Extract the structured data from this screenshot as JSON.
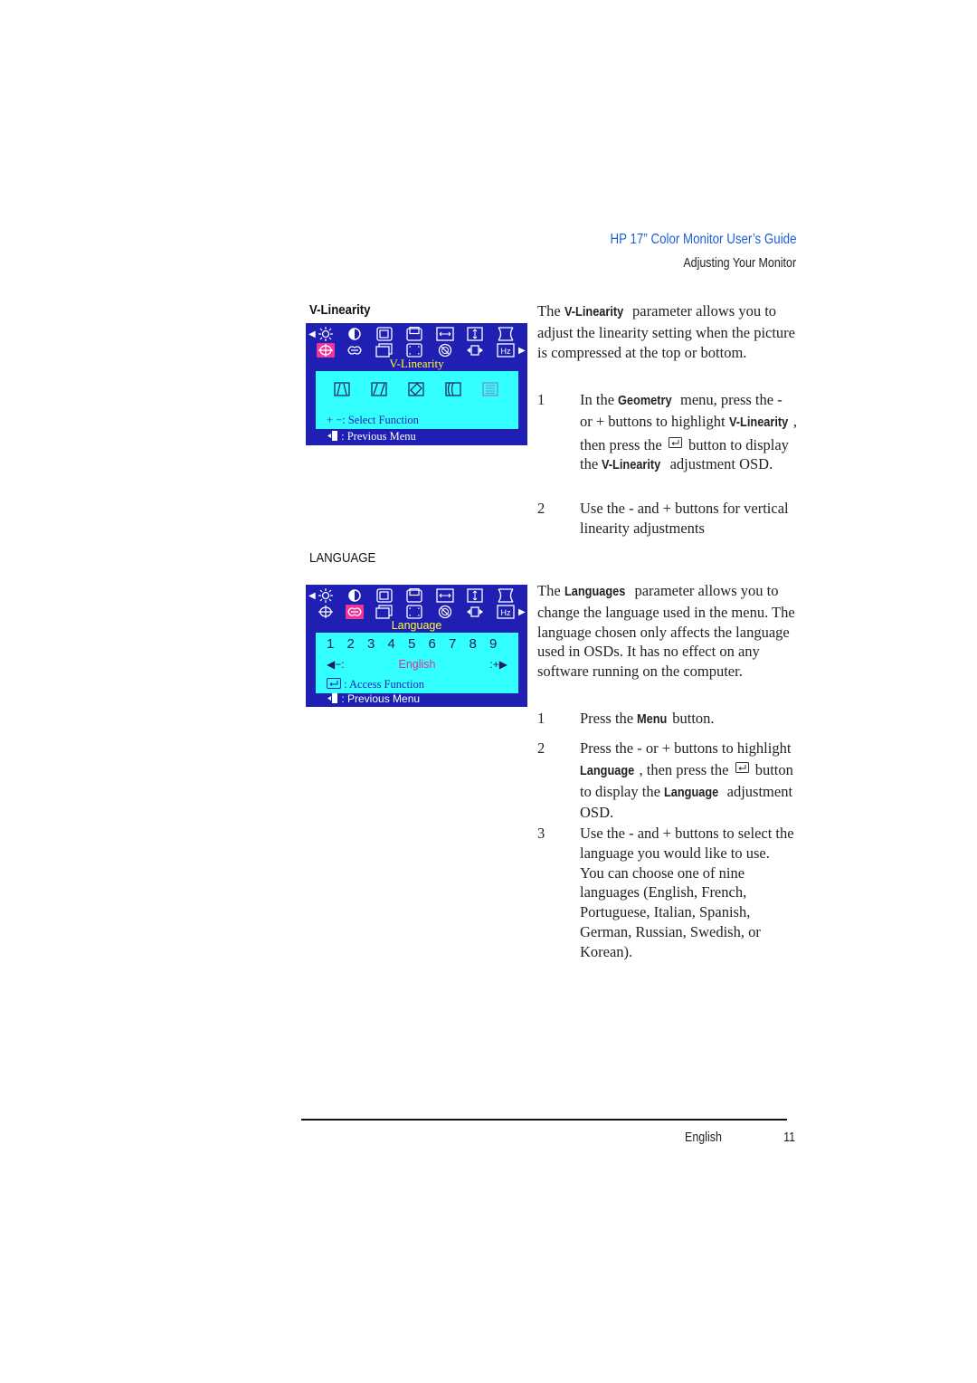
{
  "header": {
    "title": "HP 17” Color Monitor User’s Guide",
    "subtitle": "Adjusting Your Monitor"
  },
  "colors": {
    "header_blue": "#1a5fd8",
    "osd_blue": "#1f1fb4",
    "osd_cyan": "#33ffff",
    "osd_yellow": "#ffff33",
    "osd_highlight": "#f0359a"
  },
  "vlinearity": {
    "section_label": "V-Linearity",
    "osd": {
      "top_icons": [
        "brightness-icon",
        "contrast-icon",
        "h-position-icon",
        "v-position-icon",
        "h-size-icon",
        "v-size-icon",
        "pincushion-icon"
      ],
      "bottom_icons": [
        "geometry-icon",
        "language-icon",
        "recall-icon",
        "zoom-icon",
        "degauss-icon",
        "moire-icon",
        "frequency-icon"
      ],
      "selected_icon": "geometry-icon",
      "title": "V-Linearity",
      "function_icons": [
        "trapezoid-icon",
        "parallelogram-icon",
        "rotation-icon",
        "pinbalance-icon",
        "vlinearity-icon"
      ],
      "hint": "+ −: Select Function",
      "footer": ": Previous Menu"
    },
    "intro": {
      "pre": "The ",
      "kw": "V-Linearity",
      "post": " parameter allows you to adjust the linearity setting when the picture is compressed at the top or bottom."
    },
    "steps": [
      {
        "num": "1",
        "p1": "In the ",
        "kw1": "Geometry",
        "p2": " menu, press the - or + buttons to highlight ",
        "kw2": "V-Linearity",
        "p3": ", then press the",
        "p4": "button to display the ",
        "kw3": "V-Linearity",
        "p5": " adjustment OSD."
      },
      {
        "num": "2",
        "text": "Use the - and + buttons for vertical linearity adjustments"
      }
    ]
  },
  "language": {
    "section_label": "LANGUAGE",
    "osd": {
      "selected_icon": "language-icon",
      "title": "Language",
      "numbers": [
        "1",
        "2",
        "3",
        "4",
        "5",
        "6",
        "7",
        "8",
        "9"
      ],
      "left_control": "◀−:",
      "current_value": "English",
      "right_control": ":+▶",
      "hint": ": Access Function",
      "footer": ": Previous Menu"
    },
    "intro": {
      "pre": "The ",
      "kw": "Languages",
      "post": " parameter allows you to change the language used in the menu. The language chosen only affects the language used in OSDs. It has no effect on any software running on the computer."
    },
    "steps": [
      {
        "num": "1",
        "p1": "Press the ",
        "kw1": "Menu",
        "p2": " button."
      },
      {
        "num": "2",
        "p1": "Press the - or + buttons to highlight ",
        "kw1": "Language",
        "p2": ", then press the",
        "p3": "button to display the ",
        "kw2": "Language",
        "p4": " adjustment OSD."
      },
      {
        "num": "3",
        "text": "Use the - and + buttons to select the language you would like to use. You can choose one of nine languages (English, French, Portuguese, Italian, Spanish, German, Russian, Swedish, or Korean)."
      }
    ]
  },
  "footer": {
    "language": "English",
    "page_number": "11"
  }
}
